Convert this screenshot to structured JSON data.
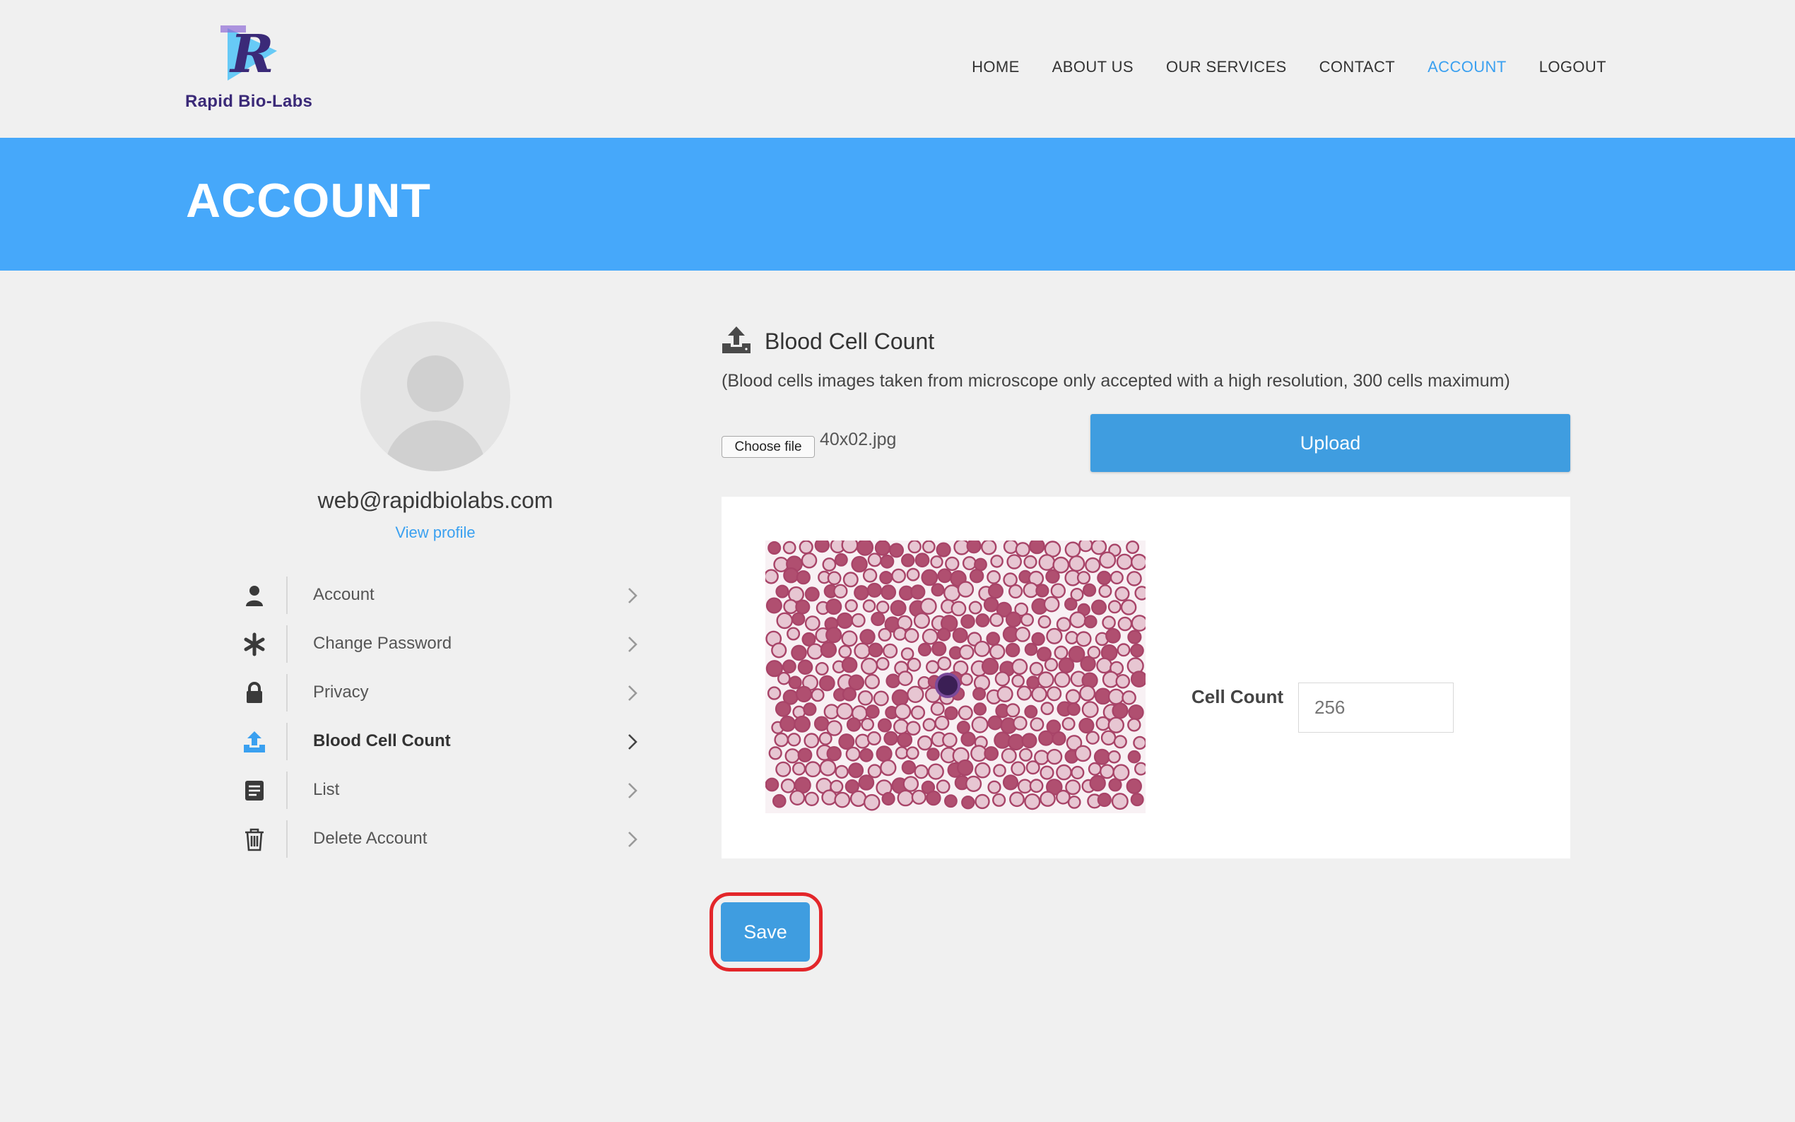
{
  "brand": {
    "name": "Rapid Bio-Labs",
    "logo_letter": "R",
    "colors": {
      "primary": "#46a8fa",
      "button": "#3f9de0",
      "logo_dark": "#3b2a78",
      "logo_light": "#4fc3f7",
      "highlight": "#e3262a"
    }
  },
  "nav": {
    "items": [
      {
        "label": "HOME",
        "active": false
      },
      {
        "label": "ABOUT US",
        "active": false
      },
      {
        "label": "OUR SERVICES",
        "active": false
      },
      {
        "label": "CONTACT",
        "active": false
      },
      {
        "label": "ACCOUNT",
        "active": true
      },
      {
        "label": "LOGOUT",
        "active": false
      }
    ]
  },
  "banner": {
    "title": "ACCOUNT"
  },
  "profile": {
    "email": "web@rapidbiolabs.com",
    "view_profile_label": "View profile"
  },
  "sidebar": {
    "items": [
      {
        "label": "Account",
        "icon": "user-icon",
        "active": false
      },
      {
        "label": "Change Password",
        "icon": "asterisk-icon",
        "active": false
      },
      {
        "label": "Privacy",
        "icon": "lock-icon",
        "active": false
      },
      {
        "label": "Blood Cell Count",
        "icon": "upload-icon",
        "active": true
      },
      {
        "label": "List",
        "icon": "list-icon",
        "active": false
      },
      {
        "label": "Delete Account",
        "icon": "trash-icon",
        "active": false
      }
    ]
  },
  "main": {
    "section_title": "Blood Cell Count",
    "note": "(Blood cells images taken from microscope only accepted with a high resolution, 300 cells maximum)",
    "file_button_label": "Choose file",
    "file_name": "40x02.jpg",
    "upload_label": "Upload",
    "cell_count_label": "Cell Count",
    "cell_count_placeholder": "256",
    "save_label": "Save"
  }
}
